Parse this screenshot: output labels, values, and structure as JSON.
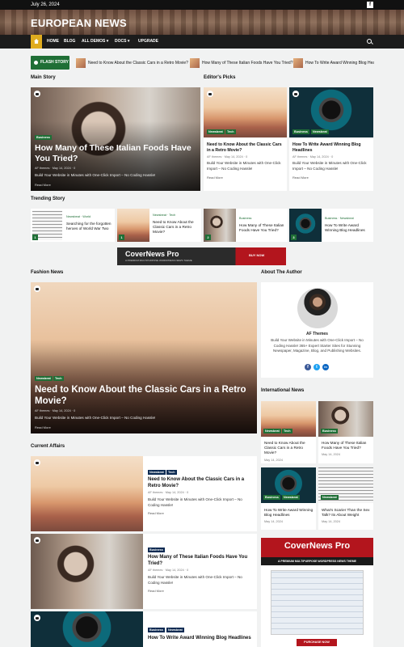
{
  "topbar": {
    "date": "July 26, 2024",
    "facebook_icon": "f"
  },
  "site": {
    "title": "EUROPEAN NEWS"
  },
  "nav": {
    "items": [
      "HOME",
      "BLOG",
      "ALL DEMOS ▾",
      "DOCS ▾",
      "UPGRADE"
    ]
  },
  "flash": {
    "label": "FLASH STORY",
    "items": [
      "Need to Know About the Classic Cars in a Retro Movie?",
      "How Many of These Italian Foods Have You Tried?",
      "How To Write Award Winning Blog Head"
    ]
  },
  "sections": {
    "main": "Main Story",
    "editors": "Editor's Picks",
    "trending": "Trending Story",
    "fashion": "Fashion News",
    "about": "About The Author",
    "international": "International News",
    "current": "Current Affairs"
  },
  "main_story": {
    "badge": "Business",
    "title": "How Many of These Italian Foods Have You Tried?",
    "author": "AF themes",
    "date": "May 14, 2024",
    "comments": "0",
    "excerpt": "Build Your Website in Minutes with One-Click Import – No Coding Hassle!",
    "more": "Read More"
  },
  "editors": [
    {
      "badges": [
        "Newsbeat",
        "Tech"
      ],
      "title": "Need to Know About the Classic Cars in a Retro Movie?",
      "author": "AF themes",
      "date": "May 14, 2024",
      "comments": "0",
      "excerpt": "Build Your Website in Minutes with One-Click Import – No Coding Hassle!",
      "more": "Read More"
    },
    {
      "badges": [
        "Business",
        "Newsbeat"
      ],
      "title": "How To Write Award Winning Blog Headlines",
      "author": "AF themes",
      "date": "May 14, 2024",
      "comments": "0",
      "excerpt": "Build Your Website in Minutes with One-Click Import – No Coding Hassle!",
      "more": "Read More"
    }
  ],
  "trending": [
    {
      "num": "1",
      "badges": [
        "Newsbeat",
        "World"
      ],
      "title": "Searching for the forgotten heroes of World War Two"
    },
    {
      "num": "1",
      "badges": [
        "Newsbeat",
        "Tech"
      ],
      "title": "Need to Know About the Classic Cars in a Retro Movie?"
    },
    {
      "num": "2",
      "badges": [
        "Business"
      ],
      "title": "How Many of These Italian Foods Have You Tried?"
    },
    {
      "num": "3",
      "badges": [
        "Business",
        "Newsbeat"
      ],
      "title": "How To Write Award Winning Blog Headlines"
    }
  ],
  "banner": {
    "brand": "CoverNews Pro",
    "tagline": "A PREMIUM MULTIPURPOSE WORDPRESS NEWS THEME",
    "cta": "BUY NOW"
  },
  "fashion": {
    "badges": [
      "Newsbeat",
      "Tech"
    ],
    "title": "Need to Know About the Classic Cars in a Retro Movie?",
    "author": "AF themes",
    "date": "May 14, 2024",
    "comments": "0",
    "excerpt": "Build Your Website in Minutes with One-Click Import – No Coding Hassle!",
    "more": "Read More"
  },
  "author": {
    "name": "AF Themes",
    "bio": "Build Your Website in Minutes with One-Click Import – No Coding Hassle! 365+ Expert Starter Sites for Stunning Newspaper, Magazine, Blog, and Publishing Websites.",
    "social": [
      "f",
      "t",
      "in"
    ]
  },
  "international": [
    {
      "badges": [
        "Newsbeat",
        "Tech"
      ],
      "title": "Need to Know About the Classic Cars in a Retro Movie?",
      "date": "May 14, 2024"
    },
    {
      "badges": [
        "Business"
      ],
      "title": "How Many of These Italian Foods Have You Tried?",
      "date": "May 14, 2024"
    },
    {
      "badges": [
        "Business",
        "Newsbeat"
      ],
      "title": "How To Write Award Winning Blog Headlines",
      "date": "May 14, 2024"
    },
    {
      "badges": [
        "Newsbeat"
      ],
      "title": "What's Scarier Than the Sex Talk? Its About Weight",
      "date": "May 14, 2024"
    }
  ],
  "sidebar_ad": {
    "brand": "CoverNews Pro",
    "tagline": "A PREMIUM MULTIPURPOSE WORDPRESS NEWS THEME",
    "cta": "PURCHASE NOW"
  },
  "current": [
    {
      "badges": [
        "Newsbeat",
        "Tech"
      ],
      "title": "Need to Know About the Classic Cars in a Retro Movie?",
      "author": "AF themes",
      "date": "May 14, 2024",
      "comments": "0",
      "excerpt": "Build Your Website in Minutes with One-Click Import – No Coding Hassle!",
      "more": "Read More"
    },
    {
      "badges": [
        "Business"
      ],
      "title": "How Many of These Italian Foods Have You Tried?",
      "author": "AF themes",
      "date": "May 14, 2024",
      "comments": "0",
      "excerpt": "Build Your Website in Minutes with One-Click Import – No Coding Hassle!",
      "more": "Read More"
    },
    {
      "badges": [
        "Business",
        "Newsbeat"
      ],
      "title": "How To Write Award Winning Blog Headlines"
    }
  ],
  "colors": {
    "accent_green": "#1f6f36",
    "navy": "#0b2a52",
    "nav_bg": "#1c1c1c",
    "home_yellow": "#e0ac1f",
    "ad_red": "#b3151d"
  }
}
